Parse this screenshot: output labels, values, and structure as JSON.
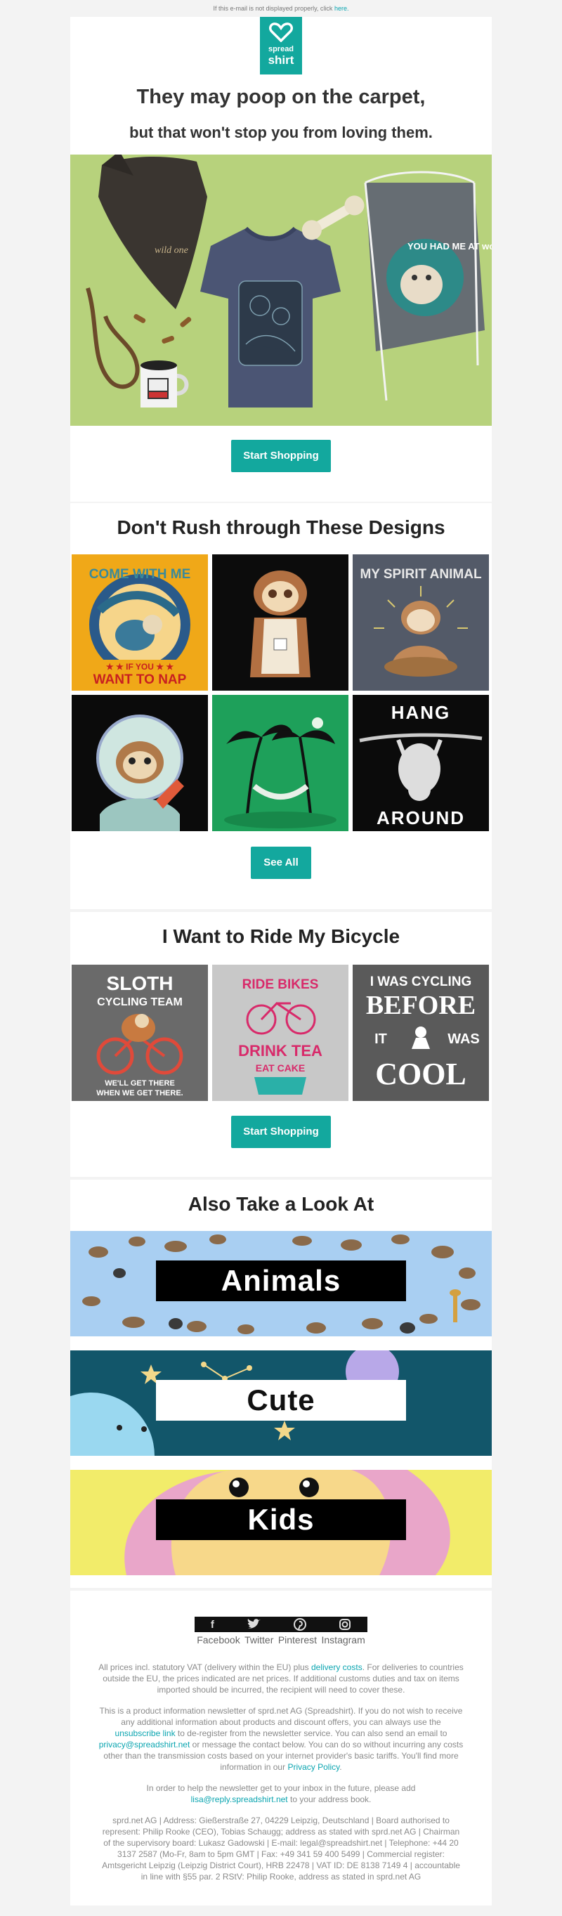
{
  "preheader": {
    "text": "If this e-mail is not displayed properly, click",
    "link": "here."
  },
  "logo": {
    "line1": "spread",
    "line2": "shirt"
  },
  "hero": {
    "title": "They may poop on the carpet,",
    "subtitle": "but that won't stop you from loving them.",
    "cta": "Start Shopping",
    "bag_text": "YOU HAD ME AT woof!",
    "bandana_text": "wild one"
  },
  "designs": {
    "heading": "Don't Rush through These Designs",
    "tile1_top": "COME WITH ME",
    "tile1_bottom1": "★ ★ IF YOU ★ ★",
    "tile1_bottom2": "WANT TO NAP",
    "tile3_text": "MY SPIRIT ANIMAL",
    "tile6_top": "HANG",
    "tile6_bottom": "AROUND",
    "cta": "See All"
  },
  "bicycle": {
    "heading": "I Want to Ride My Bicycle",
    "tile1_top1": "SLOTH",
    "tile1_top2": "CYCLING TEAM",
    "tile1_bottom1": "WE'LL GET THERE",
    "tile1_bottom2": "WHEN WE GET THERE.",
    "tile2_top": "RIDE BIKES",
    "tile2_mid": "DRINK TEA",
    "tile2_bottom": "EAT CAKE",
    "tile3_line1": "I WAS CYCLING",
    "tile3_line2": "BEFORE",
    "tile3_line3": "IT",
    "tile3_line4": "WAS",
    "tile3_line5": "COOL",
    "cta": "Start Shopping"
  },
  "also": {
    "heading": "Also Take a Look At",
    "banners": [
      "Animals",
      "Cute",
      "Kids"
    ]
  },
  "social": {
    "items": [
      "Facebook",
      "Twitter",
      "Pinterest",
      "Instagram"
    ]
  },
  "footer": {
    "p1_a": "All prices incl. statutory VAT (delivery within the EU) plus",
    "p1_link": "delivery costs",
    "p1_b": ". For deliveries to countries outside the EU, the prices indicated are net prices. If additional customs duties and tax on items imported should be incurred, the recipient will need to cover these.",
    "p2_a": "This is a product information newsletter of sprd.net AG (Spreadshirt). If you do not wish to receive any additional information about products and discount offers, you can always use the",
    "p2_link1": "unsubscribe link",
    "p2_b": "to de-register from the newsletter service. You can also send an email to",
    "p2_link2": "privacy@spreadshirt.net",
    "p2_c": "or message the contact below. You can do so without incurring any costs other than the transmission costs based on your internet provider's basic tariffs. You'll find more information in our",
    "p2_link3": "Privacy Policy",
    "p2_d": ".",
    "p3_a": "In order to help the newsletter get to your inbox in the future, please add",
    "p3_link": "lisa@reply.spreadshirt.net",
    "p3_b": "to your address book.",
    "p4": "sprd.net AG | Address: Gießerstraße 27, 04229 Leipzig, Deutschland | Board authorised to represent: Philip Rooke (CEO), Tobias Schaugg; address as stated with sprd.net AG | Chairman of the supervisory board: Lukasz Gadowski | E-mail: legal@spreadshirt.net | Telephone: +44 20 3137 2587 (Mo-Fr, 8am to 5pm GMT | Fax: +49 341 59 400 5499 | Commercial register: Amtsgericht Leipzig (Leipzig District Court), HRB 22478 | VAT ID: DE 8138 7149 4 | accountable in line with §55 par. 2 RStV: Philip Rooke, address as stated in sprd.net AG"
  },
  "colors": {
    "accent": "#13a89e",
    "link": "#0ba5b0",
    "background": "#f3f3f3"
  }
}
